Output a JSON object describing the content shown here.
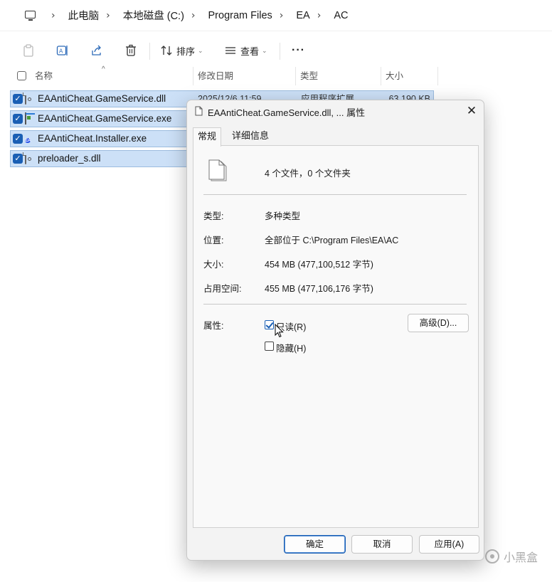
{
  "breadcrumb": {
    "items": [
      "此电脑",
      "本地磁盘 (C:)",
      "Program Files",
      "EA",
      "AC"
    ],
    "separator": "›"
  },
  "toolbar": {
    "sort_label": "排序",
    "view_label": "查看",
    "more_label": "···"
  },
  "columns": {
    "name": "名称",
    "date": "修改日期",
    "type": "类型",
    "size": "大小"
  },
  "files": [
    {
      "name": "EAAntiCheat.GameService.dll",
      "date": "2025/12/6 11:59",
      "type": "应用程序扩展",
      "size": "63,190 KB",
      "icon": "dll-file-icon",
      "selected": true
    },
    {
      "name": "EAAntiCheat.GameService.exe",
      "date": "",
      "type": "",
      "size": "",
      "icon": "exe-file-icon",
      "selected": true
    },
    {
      "name": "EAAntiCheat.Installer.exe",
      "date": "",
      "type": "",
      "size": "",
      "icon": "ea-logo-icon",
      "selected": true
    },
    {
      "name": "preloader_s.dll",
      "date": "",
      "type": "",
      "size": "",
      "icon": "dll-file-icon",
      "selected": true
    }
  ],
  "dialog": {
    "title": "EAAntiCheat.GameService.dll, ... 属性",
    "tabs": [
      "常规",
      "详细信息"
    ],
    "active_tab": "常规",
    "summary": "4 个文件，0 个文件夹",
    "type_label": "类型:",
    "type_value": "多种类型",
    "location_label": "位置:",
    "location_value": "全部位于 C:\\Program Files\\EA\\AC",
    "size_label": "大小:",
    "size_value": "454 MB (477,100,512 字节)",
    "disk_label": "占用空间:",
    "disk_value": "455 MB (477,106,176 字节)",
    "attributes_label": "属性:",
    "readonly_label": "只读(R)",
    "readonly_checked": true,
    "hidden_label": "隐藏(H)",
    "hidden_checked": false,
    "advanced_button": "高级(D)...",
    "ok_button": "确定",
    "cancel_button": "取消",
    "apply_button": "应用(A)"
  },
  "watermark": {
    "text": "小黑盒"
  },
  "colors": {
    "selection_bg": "#cce0f7",
    "accent": "#1a5fb4",
    "dialog_bg": "#f3f3f3"
  }
}
